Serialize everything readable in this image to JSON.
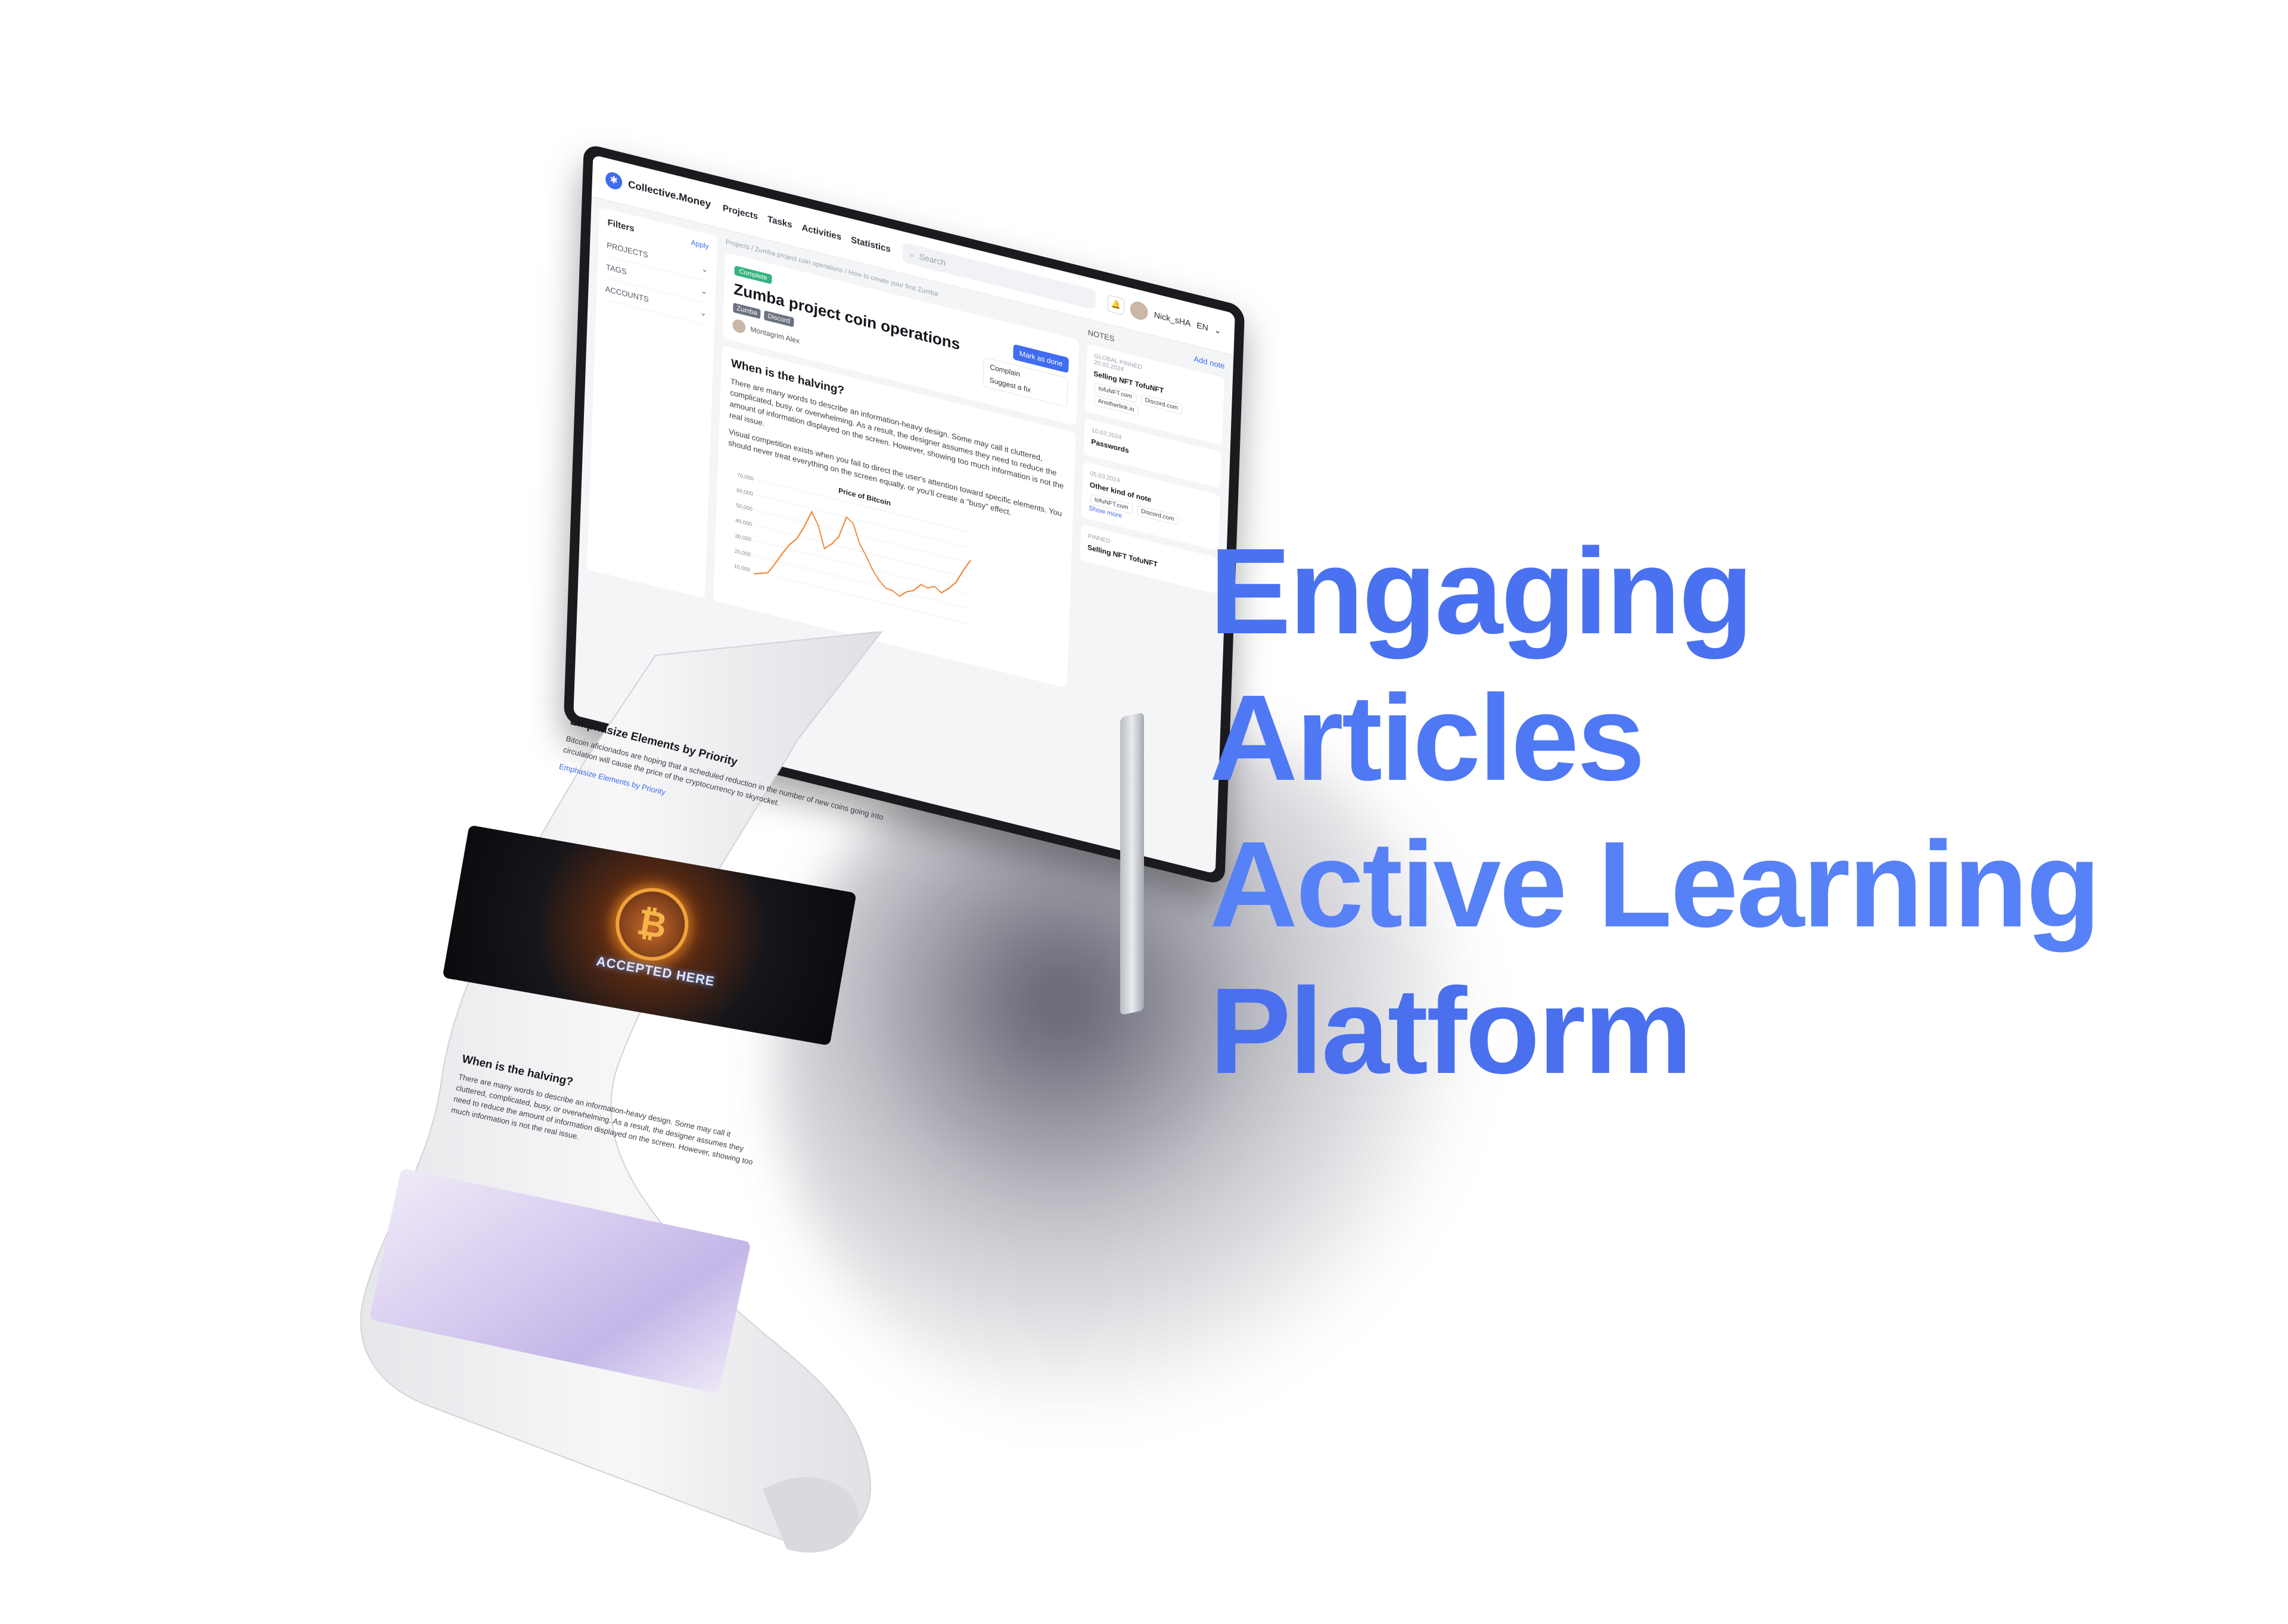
{
  "headline": {
    "line1": "Engaging",
    "line2": "Articles",
    "line3": "Active Learning",
    "line4": "Platform",
    "color": "#4a72f0"
  },
  "app": {
    "logo": "Collective.Money",
    "nav": [
      "Projects",
      "Tasks",
      "Activities",
      "Statistics"
    ],
    "search_placeholder": "Search",
    "user_name": "Nick_sHA",
    "language": "EN",
    "breadcrumb": "Projects / Zumba project coin operations / How to create your first Zumba"
  },
  "filters": {
    "title": "Filters",
    "apply": "Apply",
    "rows": [
      "PROJECTS",
      "TAGS",
      "ACCOUNTS"
    ]
  },
  "article": {
    "status": "Complete",
    "title": "Zumba project coin operations",
    "tags": [
      "Zumba",
      "Discord"
    ],
    "mark_done": "Mark as done",
    "author": "Montagrim Alex",
    "menu": [
      "Complain",
      "Suggest a fix"
    ],
    "h1": "When is the halving?",
    "p1": "There are many words to describe an information-heavy design. Some may call it cluttered, complicated, busy, or overwhelming. As a result, the designer assumes they need to reduce the amount of information displayed on the screen. However, showing too much information is not the real issue.",
    "p2": "Visual competition exists when you fail to direct the user's attention toward specific elements. You should never treat everything on the screen equally, or you'll create a \"busy\" effect.",
    "h2": "Emphasize Elements by Priority",
    "p3": "Bitcoin aficionados are hoping that a scheduled reduction in the number of new coins going into circulation will cause the price of the cryptocurrency to skyrocket.",
    "link": "Emphasize Elements by Priority",
    "img_text": "ACCEPTED HERE",
    "h3": "When is the halving?"
  },
  "chart_data": {
    "type": "line",
    "title": "Price of Bitcoin",
    "y_ticks": [
      "70,000",
      "60,000",
      "50,000",
      "40,000",
      "30,000",
      "20,000",
      "10,000"
    ],
    "ylim": [
      0,
      70000
    ],
    "series": [
      {
        "values": [
          8000,
          9500,
          11000,
          18000,
          26000,
          33000,
          38000,
          47000,
          58000,
          50000,
          36000,
          40000,
          46000,
          60000,
          57000,
          45000,
          38000,
          30000,
          24000,
          20000,
          19500,
          17000,
          21000,
          23000,
          28000,
          27000,
          29000,
          26000,
          30000,
          35000,
          44000,
          52000
        ],
        "color": "#f0883a"
      }
    ]
  },
  "notes": {
    "title": "NOTES",
    "add": "Add note",
    "global_pinned": "GLOBAL PINNED",
    "items": [
      {
        "label": "20.03.2024",
        "title": "Selling NFT TofuNFT",
        "chips": [
          "tofuNFT.com",
          "Discord.com",
          "Anotherlink.io"
        ]
      },
      {
        "label": "10.03.2024",
        "title": "Passwords",
        "chips": []
      },
      {
        "label": "05.03.2024",
        "title": "Other kind of note",
        "chips": [
          "tofuNFT.com",
          "Discord.com"
        ]
      }
    ],
    "show_more": "Show more",
    "pinned": "PINNED",
    "pinned_item": "Selling NFT TofuNFT"
  }
}
